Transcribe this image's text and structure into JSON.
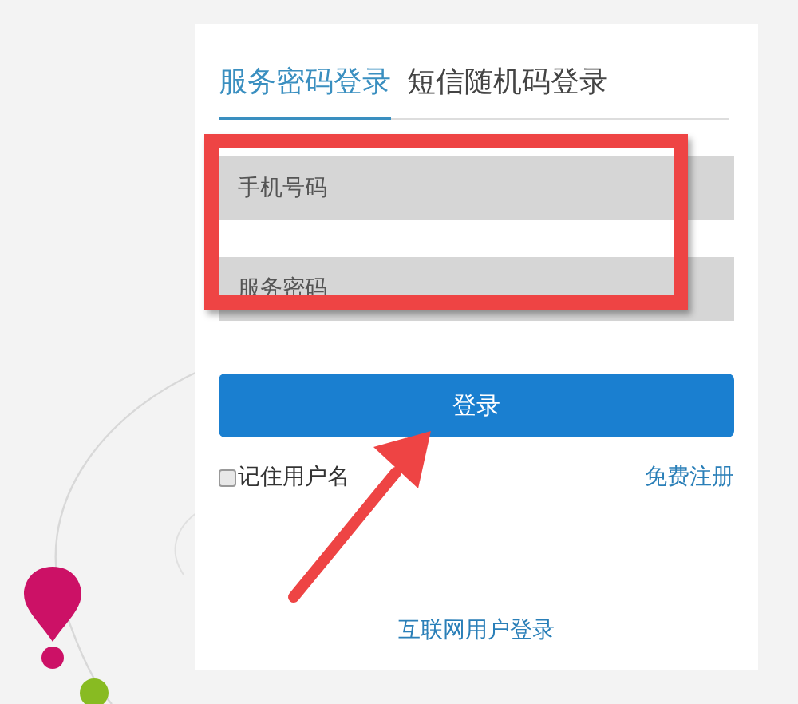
{
  "tabs": [
    {
      "label": "服务密码登录",
      "selected": true
    },
    {
      "label": "短信随机码登录",
      "selected": false
    }
  ],
  "fields": [
    {
      "placeholder": "手机号码"
    },
    {
      "placeholder": "服务密码"
    }
  ],
  "login_button": "登录",
  "remember": {
    "label": "记住用户名",
    "checked": false
  },
  "register_link": "免费注册",
  "internet_login_link": "互联网用户登录"
}
